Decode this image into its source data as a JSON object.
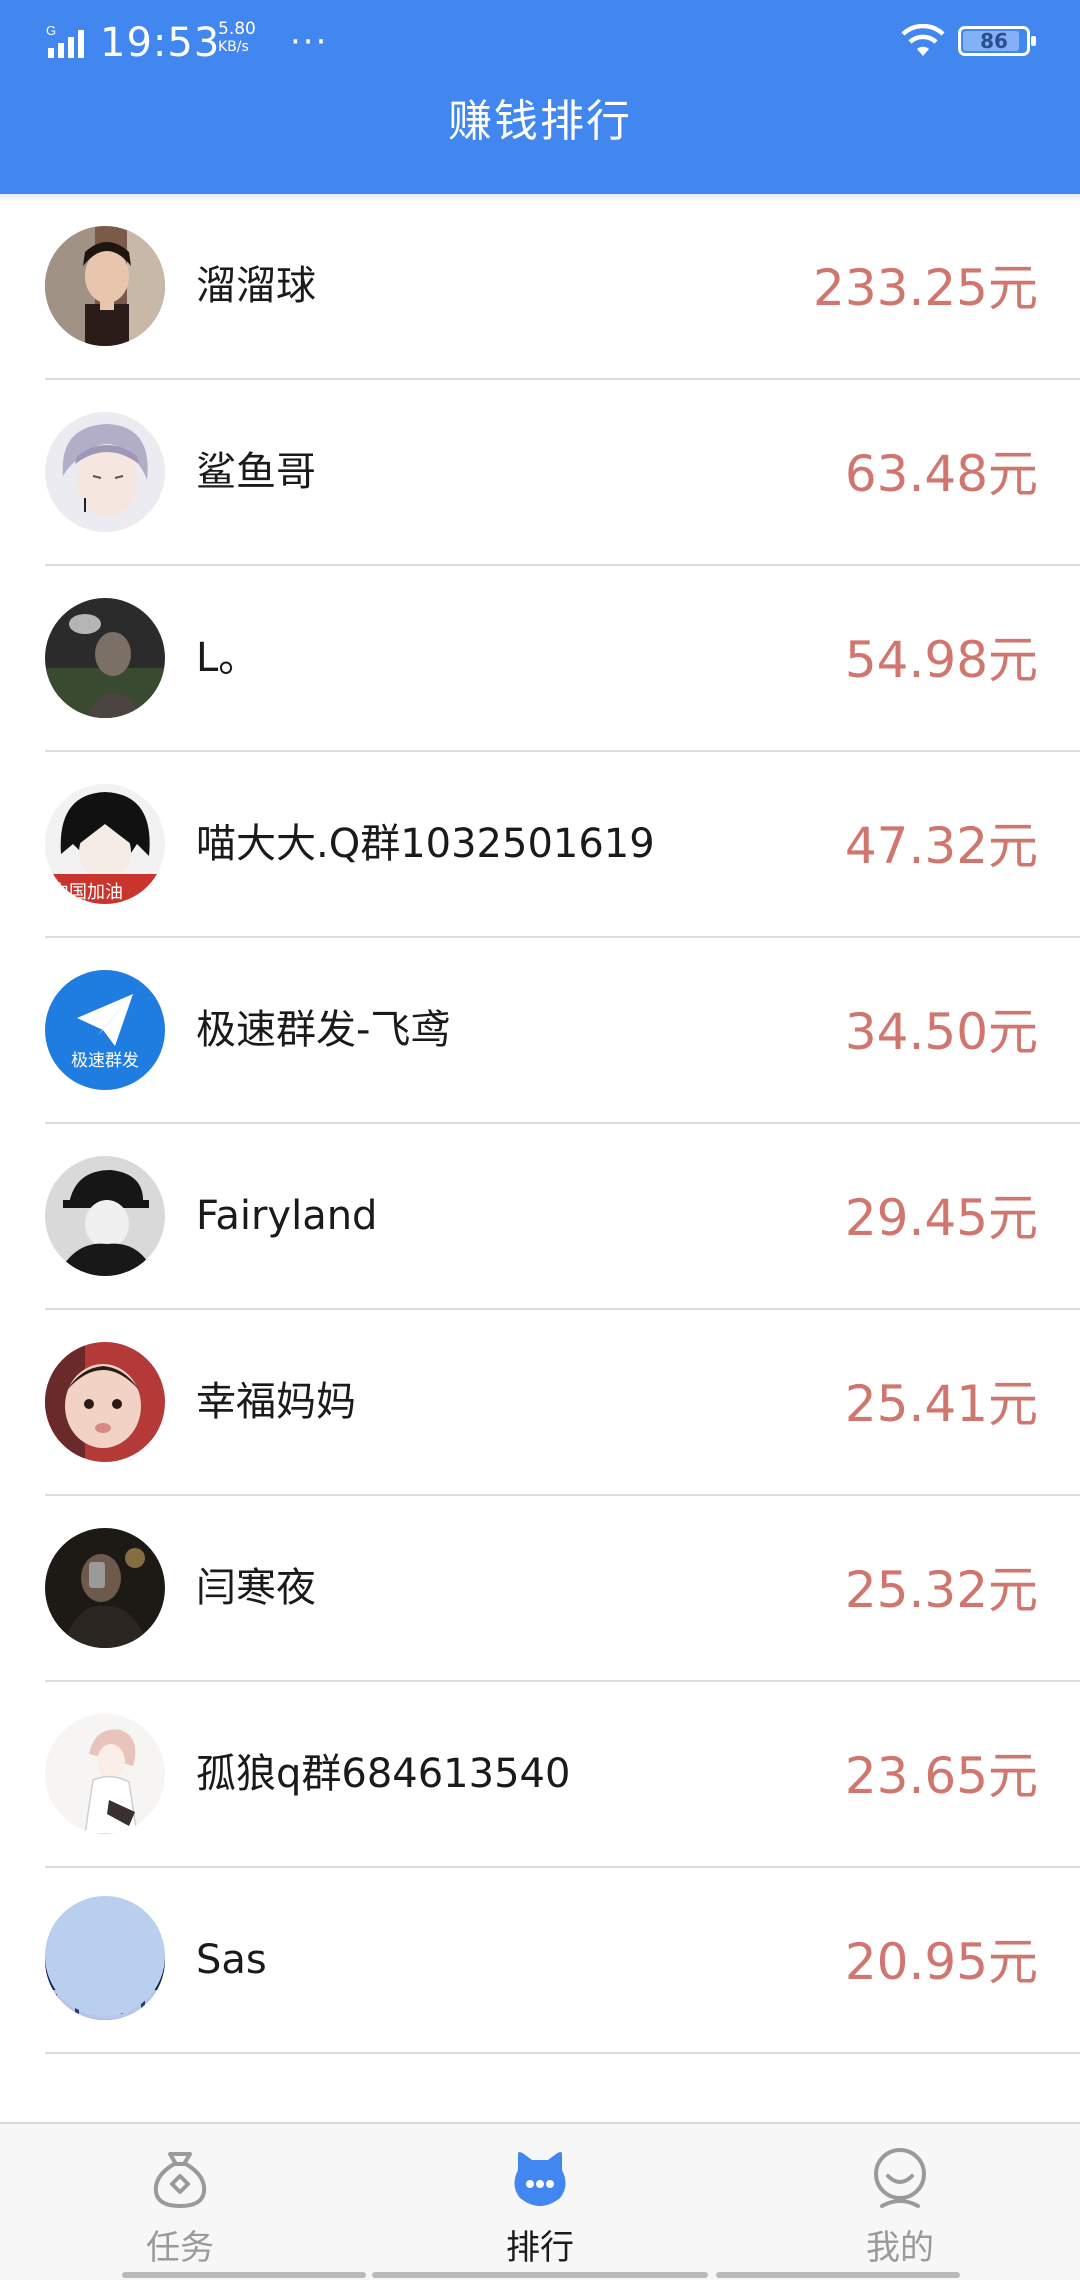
{
  "status_bar": {
    "network": "G",
    "time": "19:53",
    "speed_value": "5.80",
    "speed_unit": "KB/s",
    "more": "···",
    "battery": "86"
  },
  "header": {
    "title": "赚钱排行"
  },
  "ranking": [
    {
      "name": "溜溜球",
      "amount": "233.25元",
      "avatar": "portrait-girl"
    },
    {
      "name": "鲨鱼哥",
      "amount": "63.48元",
      "avatar": "anime-silver-hair"
    },
    {
      "name": "L。",
      "amount": "54.98元",
      "avatar": "night-figure"
    },
    {
      "name": "喵大大.Q群1032501619",
      "amount": "47.32元",
      "avatar": "anime-dark-hair"
    },
    {
      "name": "极速群发-飞鸢",
      "amount": "34.50元",
      "avatar": "paper-plane-logo",
      "avatar_text": "极速群发"
    },
    {
      "name": "Fairyland",
      "amount": "29.45元",
      "avatar": "bw-cap-man"
    },
    {
      "name": "幸福妈妈",
      "amount": "25.41元",
      "avatar": "baby-face"
    },
    {
      "name": "闫寒夜",
      "amount": "25.32元",
      "avatar": "phone-selfie"
    },
    {
      "name": "孤狼q群684613540",
      "amount": "23.65元",
      "avatar": "anime-pink-hair"
    },
    {
      "name": "Sas",
      "amount": "20.95元",
      "avatar": "blue-night-city"
    }
  ],
  "bottom_nav": {
    "items": [
      {
        "label": "任务",
        "icon": "money-bag-icon",
        "active": false
      },
      {
        "label": "排行",
        "icon": "ranking-chat-icon",
        "active": true
      },
      {
        "label": "我的",
        "icon": "smiley-user-icon",
        "active": false
      }
    ]
  },
  "colors": {
    "header": "#4287f0",
    "amount": "#d0766e",
    "active_tab": "#4287f0",
    "inactive_tab": "#9a9a9a"
  }
}
